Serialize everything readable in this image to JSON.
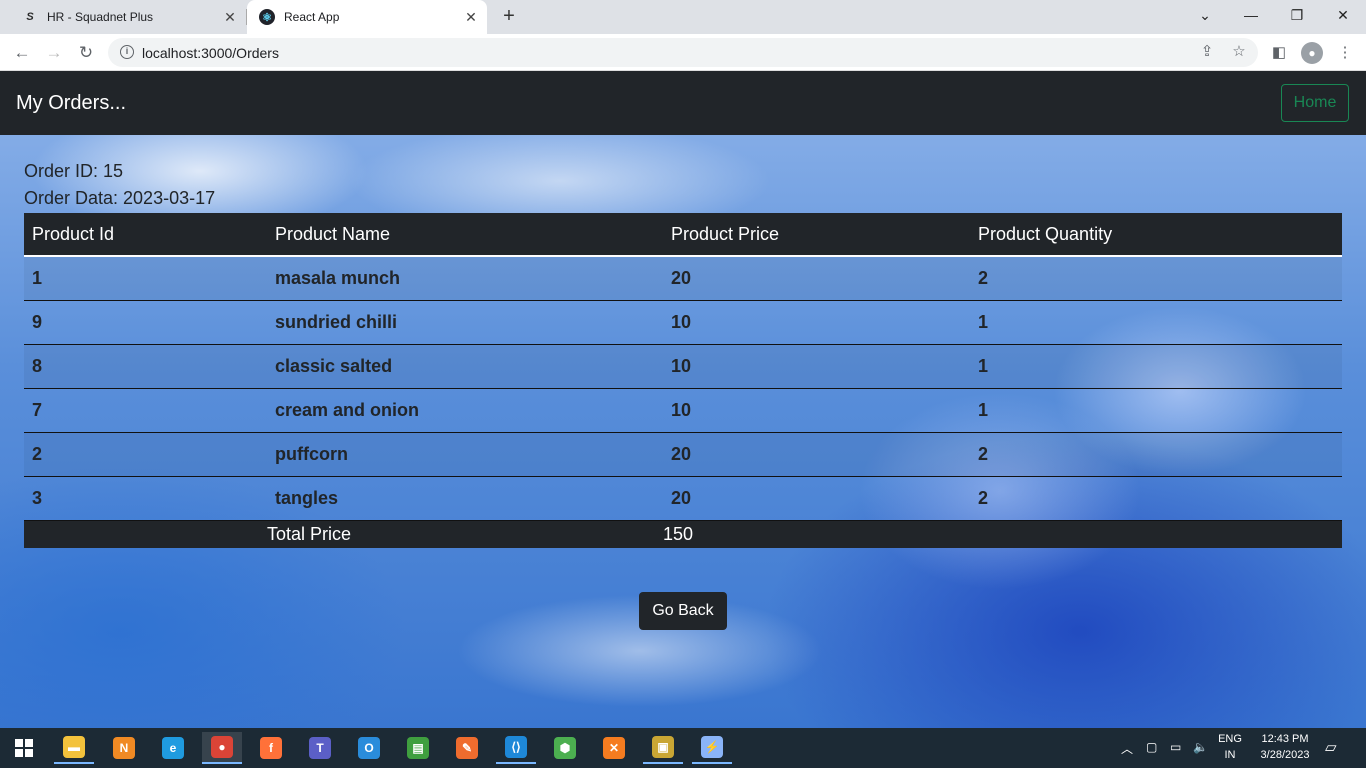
{
  "browser": {
    "tabs": [
      {
        "title": "HR - Squadnet Plus",
        "favicon": "S"
      },
      {
        "title": "React App",
        "favicon": "⚛"
      }
    ],
    "url": "localhost:3000/Orders"
  },
  "page": {
    "brand": "My Orders...",
    "home_label": "Home",
    "order_id_text": "Order ID: 15",
    "order_date_text": "Order Data: 2023-03-17",
    "table": {
      "headers": [
        "Product Id",
        "Product Name",
        "Product Price",
        "Product Quantity"
      ],
      "rows": [
        [
          "1",
          "masala munch",
          "20",
          "2"
        ],
        [
          "9",
          "sundried chilli",
          "10",
          "1"
        ],
        [
          "8",
          "classic salted",
          "10",
          "1"
        ],
        [
          "7",
          "cream and onion",
          "10",
          "1"
        ],
        [
          "2",
          "puffcorn",
          "20",
          "2"
        ],
        [
          "3",
          "tangles",
          "20",
          "2"
        ]
      ],
      "total_label": "Total Price",
      "total_value": "150"
    },
    "go_back_label": "Go Back"
  },
  "taskbar": {
    "apps": [
      {
        "name": "file-explorer",
        "glyph": "▬",
        "color": "#f3c23c"
      },
      {
        "name": "app-n",
        "glyph": "N",
        "color": "#f08a24"
      },
      {
        "name": "edge",
        "glyph": "e",
        "color": "#1f9be0"
      },
      {
        "name": "chrome",
        "glyph": "●",
        "color": "#db4437"
      },
      {
        "name": "firefox",
        "glyph": "f",
        "color": "#ff7139"
      },
      {
        "name": "teams",
        "glyph": "T",
        "color": "#5b5fc7"
      },
      {
        "name": "outlook",
        "glyph": "O",
        "color": "#2a8cdb"
      },
      {
        "name": "sheet",
        "glyph": "▤",
        "color": "#3f9f3f"
      },
      {
        "name": "postman",
        "glyph": "✎",
        "color": "#ef6c2e"
      },
      {
        "name": "vscode",
        "glyph": "⟨⟩",
        "color": "#1e88d8"
      },
      {
        "name": "node",
        "glyph": "⬢",
        "color": "#4caf50"
      },
      {
        "name": "xampp",
        "glyph": "✕",
        "color": "#f57c20"
      },
      {
        "name": "network-tool",
        "glyph": "▣",
        "color": "#c9a634"
      },
      {
        "name": "bolt-app",
        "glyph": "⚡",
        "color": "#8ab4f8"
      }
    ],
    "lang_top": "ENG",
    "lang_bottom": "IN",
    "time": "12:43 PM",
    "date": "3/28/2023"
  }
}
